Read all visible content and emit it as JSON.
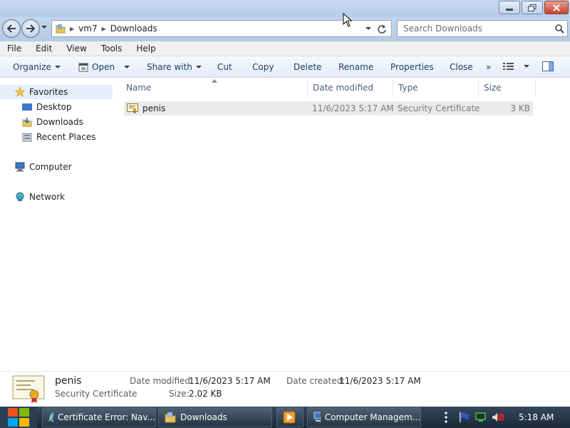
{
  "address": {
    "crumbs": [
      "vm7",
      "Downloads"
    ],
    "search_placeholder": "Search Downloads"
  },
  "menu": [
    "File",
    "Edit",
    "View",
    "Tools",
    "Help"
  ],
  "toolbar": {
    "organize": "Organize",
    "open": "Open",
    "share_with": "Share with",
    "cut": "Cut",
    "copy": "Copy",
    "delete": "Delete",
    "rename": "Rename",
    "properties": "Properties",
    "close": "Close",
    "more": "»"
  },
  "nav": {
    "favorites": "Favorites",
    "desktop": "Desktop",
    "downloads": "Downloads",
    "recent_places": "Recent Places",
    "computer": "Computer",
    "network": "Network"
  },
  "columns": {
    "name": "Name",
    "date_modified": "Date modified",
    "type": "Type",
    "size": "Size"
  },
  "files": [
    {
      "name": "penis",
      "date_modified": "11/6/2023 5:17 AM",
      "type": "Security Certificate",
      "size": "3 KB"
    }
  ],
  "details": {
    "name": "penis",
    "type": "Security Certificate",
    "date_modified_label": "Date modified:",
    "date_modified": "11/6/2023 5:17 AM",
    "date_created_label": "Date created:",
    "date_created": "11/6/2023 5:17 AM",
    "size_label": "Size:",
    "size": "2.02 KB"
  },
  "taskbar": {
    "ie_task": "Certificate Error: Nav...",
    "explorer_task": "Downloads",
    "compmgmt_task": "Computer Managem...",
    "clock": "5:18 AM"
  },
  "colors": {
    "selection": "#e5eef9",
    "file_row": "#eaeaea",
    "taskbar": "#1b2a39"
  }
}
